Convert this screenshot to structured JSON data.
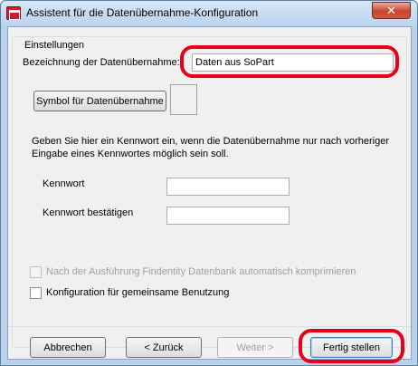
{
  "window": {
    "title": "Assistent für die Datenübernahme-Konfiguration",
    "close_glyph": "✕"
  },
  "settings": {
    "group_label": "Einstellungen",
    "name_label": "Bezeichnung der Datenübernahme:",
    "name_value": "Daten aus SoPart",
    "symbol_button": "Symbol für Datenübernahme",
    "password_hint": "Geben Sie hier ein Kennwort ein, wenn die Datenübernahme nur nach vorheriger Eingabe eines Kennwortes möglich sein soll.",
    "password_label": "Kennwort",
    "password_value": "",
    "password_confirm_label": "Kennwort bestätigen",
    "password_confirm_value": "",
    "compress_checkbox_label": "Nach der Ausführung Findentity Datenbank automatisch komprimieren",
    "shared_checkbox_label": "Konfiguration für gemeinsame Benutzung"
  },
  "footer": {
    "cancel": "Abbrechen",
    "back": "< Zurück",
    "next": "Weiter >",
    "finish": "Fertig stellen"
  },
  "annotation_color": "#e8001a"
}
